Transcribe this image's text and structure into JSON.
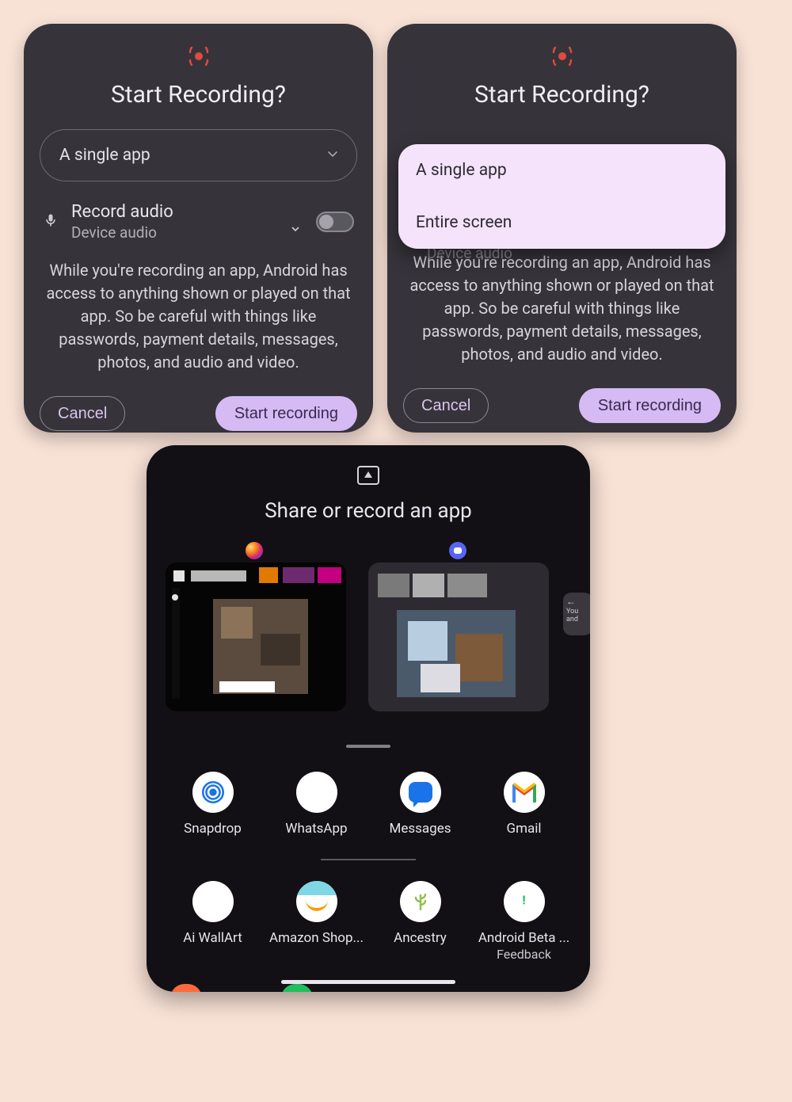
{
  "dialog1": {
    "title": "Start Recording?",
    "mode_selected": "A single app",
    "audio": {
      "title": "Record audio",
      "subtitle": "Device audio"
    },
    "warning": "While you're recording an app, Android has access to anything shown or played on that app. So be careful with things like passwords, payment details, messages, photos, and audio and video.",
    "cancel": "Cancel",
    "start": "Start recording"
  },
  "dialog2": {
    "title": "Start Recording?",
    "options": [
      "A single app",
      "Entire screen"
    ],
    "audio_subtitle_peek": "Device audio",
    "warning": "While you're recording an app, Android has access to anything shown or played on that app. So be careful with things like passwords, payment details, messages, photos, and audio and video.",
    "cancel": "Cancel",
    "start": "Start recording"
  },
  "sheet": {
    "title": "Share or record an app",
    "recents": [
      {
        "app": "Instagram"
      },
      {
        "app": "Discord"
      },
      {
        "app_peek_text": "You and"
      }
    ],
    "row1": [
      {
        "label": "Snapdrop"
      },
      {
        "label": "WhatsApp"
      },
      {
        "label": "Messages"
      },
      {
        "label": "Gmail"
      }
    ],
    "row2": [
      {
        "label": "Ai WallArt"
      },
      {
        "label": "Amazon Shop...",
        "full": "Amazon Shopping"
      },
      {
        "label": "Ancestry"
      },
      {
        "label": "Android Beta ...",
        "sub": "Feedback"
      }
    ]
  },
  "colors": {
    "accent": "#d6baf4",
    "panel": "#36343a",
    "sheet": "#121015",
    "record": "#e04a3f"
  }
}
